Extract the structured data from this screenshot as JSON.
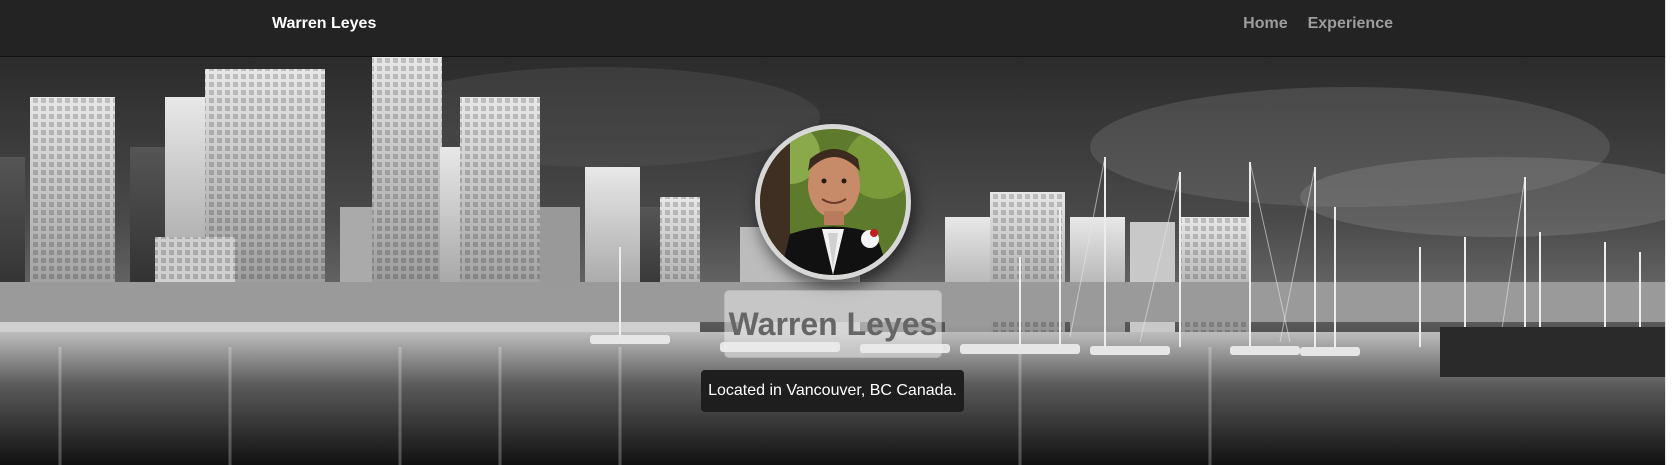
{
  "navbar": {
    "brand": "Warren Leyes",
    "links": [
      {
        "label": "Home"
      },
      {
        "label": "Experience"
      }
    ]
  },
  "hero": {
    "name": "Warren Leyes",
    "location": "Located in Vancouver, BC Canada.",
    "background_icon": "city-skyline-image",
    "avatar_icon": "profile-photo"
  },
  "colors": {
    "navbar_bg": "#232323",
    "brand_text": "#ffffff",
    "nav_link_text": "#9d9d9d",
    "name_text": "#666666",
    "badge_bg": "#1e1e1e"
  }
}
